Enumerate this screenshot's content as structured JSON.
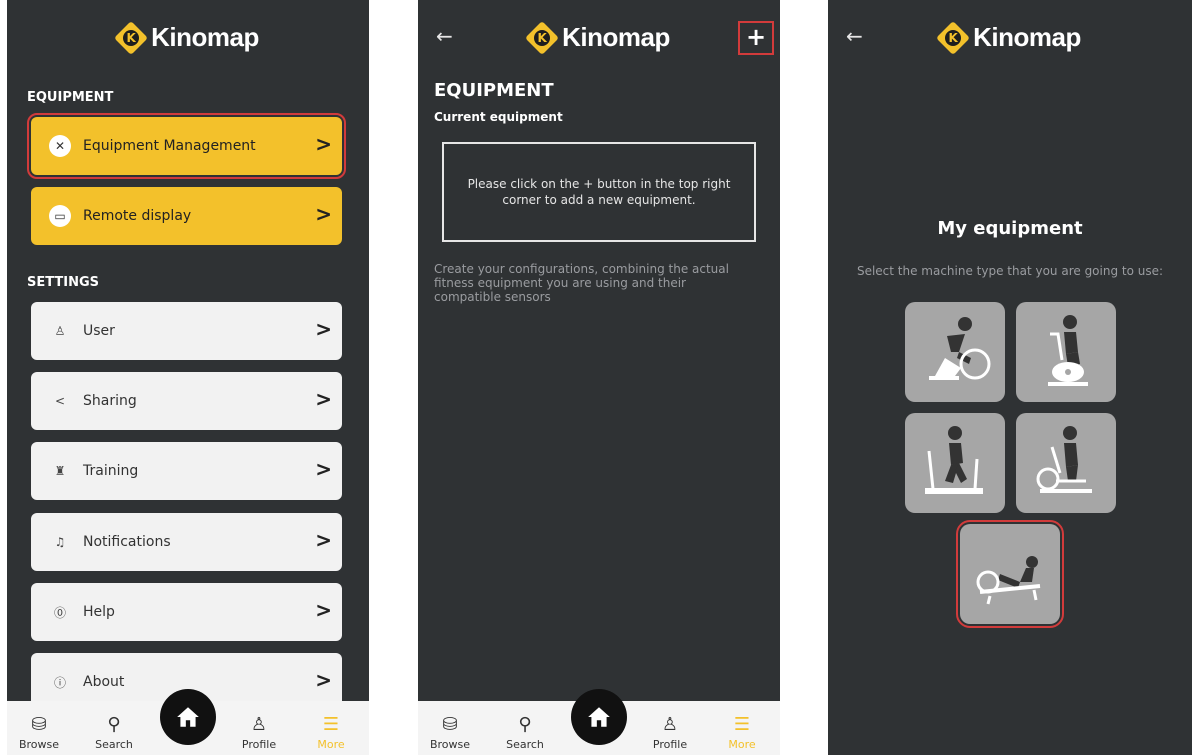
{
  "brand": {
    "name": "Kinomap",
    "logo_letter": "K",
    "accent": "#f3c12b",
    "highlight": "#d23b3b",
    "bg": "#2f3234"
  },
  "screen1": {
    "sections": {
      "equipment": "EQUIPMENT",
      "settings": "SETTINGS"
    },
    "equipment_items": [
      {
        "label": "Equipment Management",
        "icon": "wrench-icon",
        "highlighted": true
      },
      {
        "label": "Remote display",
        "icon": "monitor-icon"
      }
    ],
    "settings_items": [
      {
        "label": "User",
        "icon": "user-icon"
      },
      {
        "label": "Sharing",
        "icon": "share-icon"
      },
      {
        "label": "Training",
        "icon": "trophy-icon"
      },
      {
        "label": "Notifications",
        "icon": "bell-icon"
      },
      {
        "label": "Help",
        "icon": "help-icon"
      },
      {
        "label": "About",
        "icon": "info-icon"
      }
    ]
  },
  "screen2": {
    "title": "EQUIPMENT",
    "subtitle": "Current equipment",
    "empty_message": "Please click on the + button in the top right corner to add a new equipment.",
    "description": "Create your configurations, combining the actual fitness equipment you are using and their compatible sensors",
    "add_label": "+"
  },
  "screen3": {
    "title": "My equipment",
    "description": "Select the machine type that you are going to use:",
    "machines": [
      {
        "icon": "bike-trainer-icon"
      },
      {
        "icon": "exercise-bike-icon"
      },
      {
        "icon": "treadmill-icon"
      },
      {
        "icon": "elliptical-icon"
      },
      {
        "icon": "rowing-machine-icon",
        "highlighted": true
      }
    ]
  },
  "navbar": {
    "items": [
      {
        "label": "Browse",
        "icon": "browse-icon"
      },
      {
        "label": "Search",
        "icon": "search-icon"
      },
      {
        "label": "Profile",
        "icon": "profile-icon"
      },
      {
        "label": "More",
        "icon": "menu-icon",
        "active": true
      }
    ],
    "home_icon": "home-icon"
  }
}
